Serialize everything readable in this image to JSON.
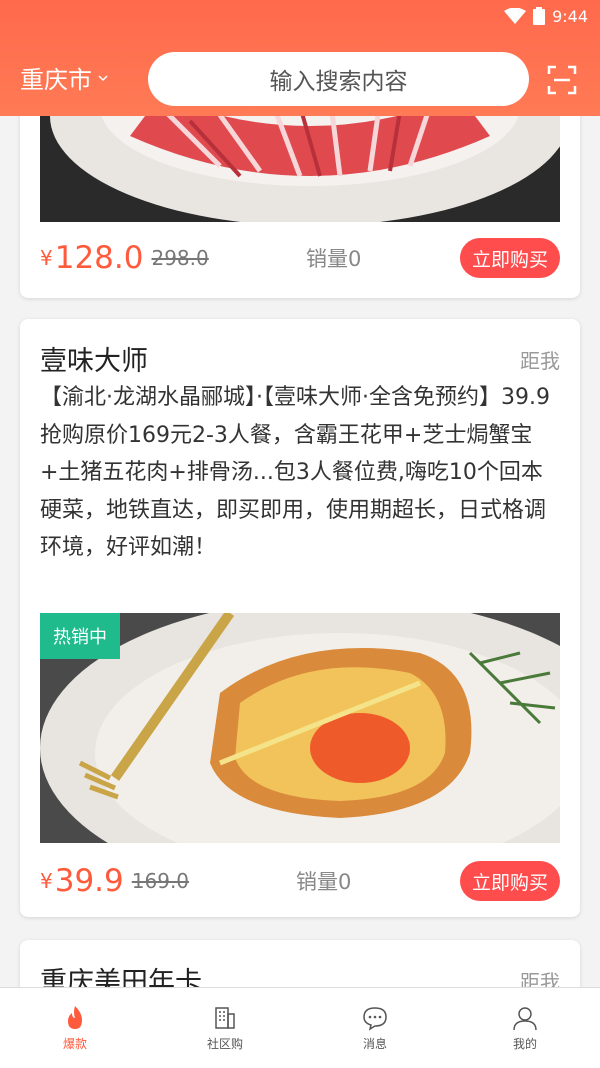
{
  "status": {
    "time": "9:44"
  },
  "header": {
    "city": "重庆市",
    "search_placeholder": "输入搜索内容"
  },
  "cards": [
    {
      "price_symbol": "¥",
      "price": "128.0",
      "old_price": "298.0",
      "sales": "销量0",
      "buy_label": "立即购买"
    },
    {
      "title": "壹味大师",
      "distance": "距我",
      "description": "【渝北·龙湖水晶郦城】·【壹味大师·全含免预约】39.9抢购原价169元2-3人餐，含霸王花甲+芝士焗蟹宝+土猪五花肉+排骨汤...包3人餐位费,嗨吃10个回本硬菜，地铁直达，即买即用，使用期超长，日式格调环境，好评如潮！",
      "badge": "热销中",
      "price_symbol": "¥",
      "price": "39.9",
      "old_price": "169.0",
      "sales": "销量0",
      "buy_label": "立即购买"
    },
    {
      "title": "重庆美田年卡",
      "distance": "距我"
    }
  ],
  "tabbar": [
    {
      "label": "爆款",
      "icon": "fire-icon",
      "active": true
    },
    {
      "label": "社区购",
      "icon": "building-icon",
      "active": false
    },
    {
      "label": "消息",
      "icon": "message-icon",
      "active": false
    },
    {
      "label": "我的",
      "icon": "user-icon",
      "active": false
    }
  ],
  "colors": {
    "header": "#ff6a4c",
    "accent": "#ff5a3c",
    "buy_button": "#ff4d4d",
    "badge": "#1fbb8c"
  }
}
